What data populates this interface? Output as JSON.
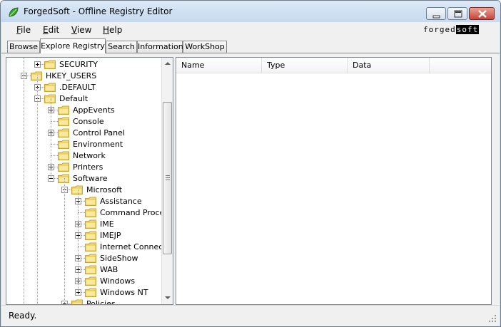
{
  "window": {
    "title": "ForgedSoft - Offline Registry Editor"
  },
  "menu": {
    "items": [
      {
        "label": "File",
        "hotkey": "F",
        "rest": "ile"
      },
      {
        "label": "Edit",
        "hotkey": "E",
        "rest": "dit"
      },
      {
        "label": "View",
        "hotkey": "V",
        "rest": "iew"
      },
      {
        "label": "Help",
        "hotkey": "H",
        "rest": "elp"
      }
    ]
  },
  "logo": {
    "part1": "forged",
    "part2": "soft"
  },
  "tabs": [
    {
      "label": "Browse",
      "active": false
    },
    {
      "label": "Explore Registry",
      "active": true
    },
    {
      "label": "Search",
      "active": false
    },
    {
      "label": "Information",
      "active": false
    },
    {
      "label": "WorkShop",
      "active": false
    }
  ],
  "tree": {
    "nodes": [
      {
        "label": "SECURITY",
        "level": 1,
        "expander": "plus"
      },
      {
        "label": "HKEY_USERS",
        "level": 0,
        "expander": "minus"
      },
      {
        "label": ".DEFAULT",
        "level": 1,
        "expander": "plus"
      },
      {
        "label": "Default",
        "level": 1,
        "expander": "minus"
      },
      {
        "label": "AppEvents",
        "level": 2,
        "expander": "plus"
      },
      {
        "label": "Console",
        "level": 2,
        "expander": "none"
      },
      {
        "label": "Control Panel",
        "level": 2,
        "expander": "plus"
      },
      {
        "label": "Environment",
        "level": 2,
        "expander": "none"
      },
      {
        "label": "Network",
        "level": 2,
        "expander": "none"
      },
      {
        "label": "Printers",
        "level": 2,
        "expander": "plus"
      },
      {
        "label": "Software",
        "level": 2,
        "expander": "minus"
      },
      {
        "label": "Microsoft",
        "level": 3,
        "expander": "minus"
      },
      {
        "label": "Assistance",
        "level": 4,
        "expander": "plus"
      },
      {
        "label": "Command Process",
        "level": 4,
        "expander": "none"
      },
      {
        "label": "IME",
        "level": 4,
        "expander": "plus"
      },
      {
        "label": "IMEJP",
        "level": 4,
        "expander": "plus"
      },
      {
        "label": "Internet Connectio",
        "level": 4,
        "expander": "none"
      },
      {
        "label": "SideShow",
        "level": 4,
        "expander": "plus"
      },
      {
        "label": "WAB",
        "level": 4,
        "expander": "plus"
      },
      {
        "label": "Windows",
        "level": 4,
        "expander": "plus"
      },
      {
        "label": "Windows NT",
        "level": 4,
        "expander": "plus"
      },
      {
        "label": "Policies",
        "level": 3,
        "expander": "plus"
      }
    ]
  },
  "list": {
    "columns": [
      "Name",
      "Type",
      "Data"
    ]
  },
  "status": {
    "text": "Ready."
  },
  "colors": {
    "folder": "#f5dd7a",
    "folder_edge": "#c9a532",
    "accent": "#2f8a2c"
  },
  "icons": {
    "app": "green-leaf-icon",
    "folder": "folder-icon"
  }
}
